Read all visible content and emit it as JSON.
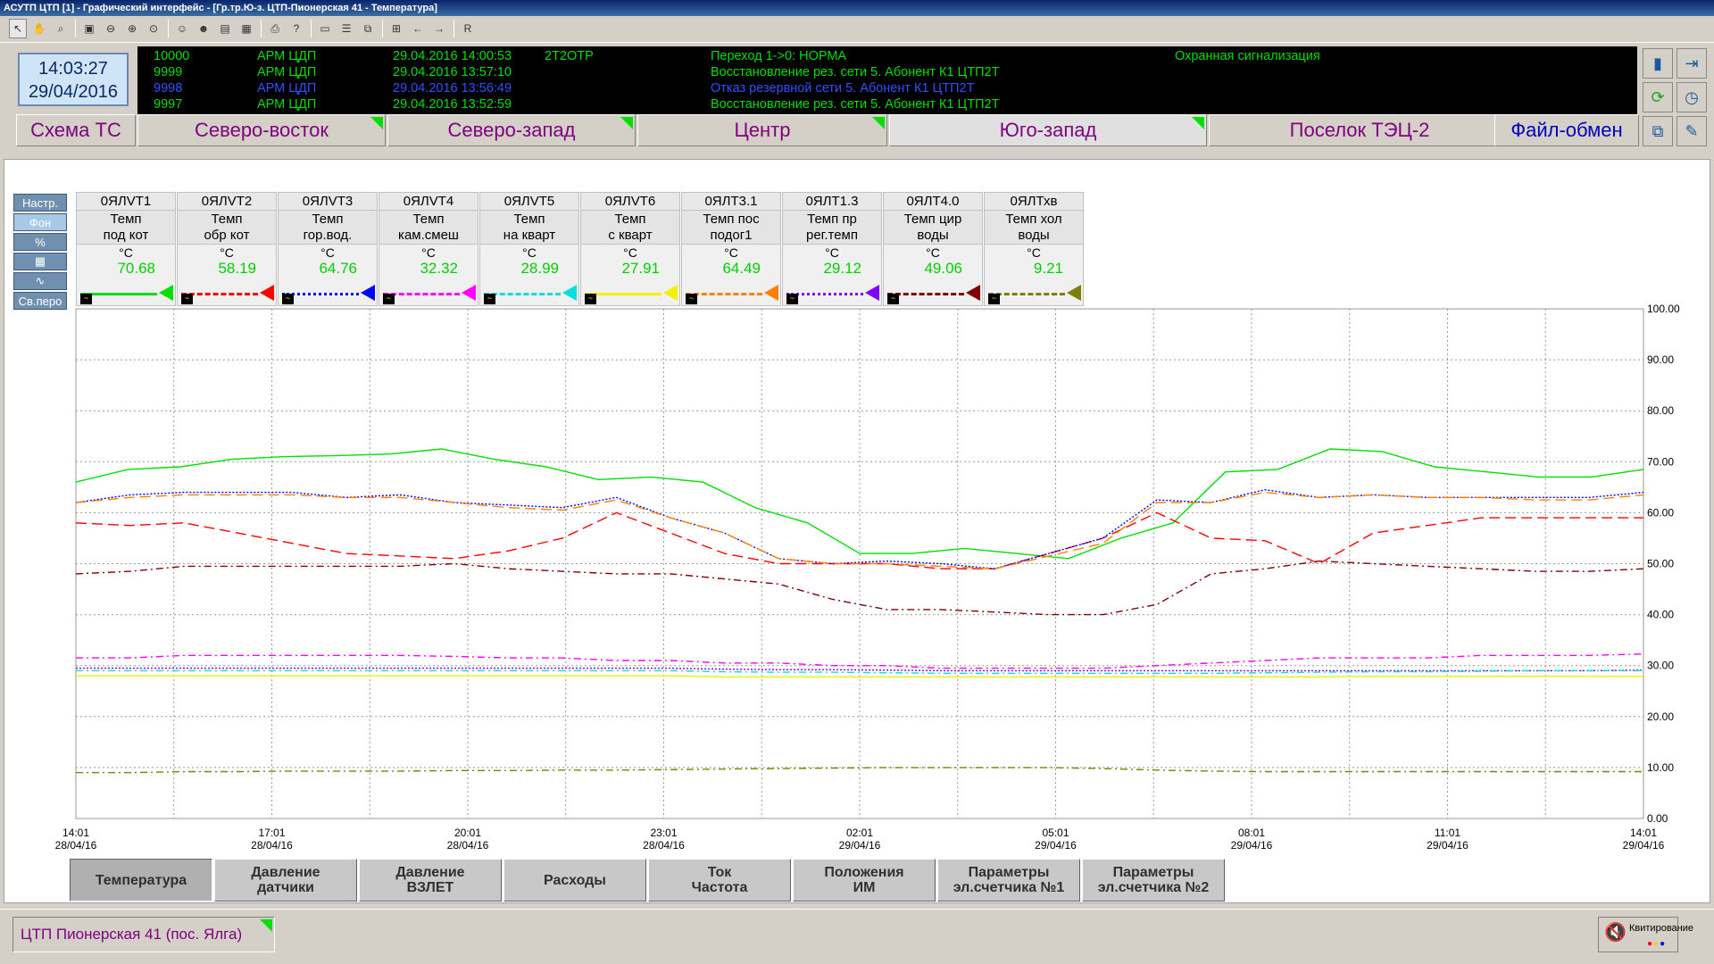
{
  "window": {
    "title": "АСУТП ЦТП [1] - Графический интерфейс - [Гр.тр.Ю-з. ЦТП-Пионерская 41 - Температура]"
  },
  "toolbar": {
    "last_label": "R"
  },
  "clock": {
    "time": "14:03:27",
    "date": "29/04/2016"
  },
  "events": [
    {
      "code": "10000",
      "src": "АРМ ЦДП",
      "ts": "29.04.2016 14:00:53",
      "obj": "2Т2ОТР",
      "msg": "Переход  1->0:      НОРМА",
      "extra": "Охранная сигнализация",
      "color": "#00e000"
    },
    {
      "code": "9999",
      "src": "АРМ ЦДП",
      "ts": "29.04.2016 13:57:10",
      "obj": "",
      "msg": "Восстановление рез. сети 5. Абонент К1 ЦТП2Т",
      "extra": "",
      "color": "#00e000"
    },
    {
      "code": "9998",
      "src": "АРМ ЦДП",
      "ts": "29.04.2016 13:56:49",
      "obj": "",
      "msg": "Отказ резервной сети  5. Абонент К1 ЦТП2Т",
      "extra": "",
      "color": "#3050ff"
    },
    {
      "code": "9997",
      "src": "АРМ ЦДП",
      "ts": "29.04.2016 13:52:59",
      "obj": "",
      "msg": "Восстановление рез. сети 5. Абонент К1 ЦТП2Т",
      "extra": "",
      "color": "#00e000"
    }
  ],
  "nav_tabs": [
    {
      "label": "Схема ТС",
      "flag": ""
    },
    {
      "label": "Северо-восток",
      "flag": "green"
    },
    {
      "label": "Северо-запад",
      "flag": "green"
    },
    {
      "label": "Центр",
      "flag": "green"
    },
    {
      "label": "Юго-запад",
      "flag": "green"
    },
    {
      "label": "Поселок ТЭЦ-2",
      "flag": "yellow"
    },
    {
      "label": "Файл-обмен",
      "flag": ""
    }
  ],
  "left_buttons": [
    "Настр.",
    "Фон",
    "%",
    "",
    "",
    "Св.перо"
  ],
  "pens": [
    {
      "tag": "0ЯЛVТ1",
      "desc1": "Темп",
      "desc2": "под кот",
      "unit": "°C",
      "value": "70.68",
      "color": "#00e000",
      "style": "solid"
    },
    {
      "tag": "0ЯЛVТ2",
      "desc1": "Темп",
      "desc2": "обр кот",
      "unit": "°C",
      "value": "58.19",
      "color": "#ff0000",
      "style": "dashed"
    },
    {
      "tag": "0ЯЛVТ3",
      "desc1": "Темп",
      "desc2": "гор.вод.",
      "unit": "°C",
      "value": "64.76",
      "color": "#0000ff",
      "style": "dotted"
    },
    {
      "tag": "0ЯЛVТ4",
      "desc1": "Темп",
      "desc2": "кам.смеш",
      "unit": "°C",
      "value": "32.32",
      "color": "#ff00ff",
      "style": "dashdot"
    },
    {
      "tag": "0ЯЛVТ5",
      "desc1": "Темп",
      "desc2": "на кварт",
      "unit": "°C",
      "value": "28.99",
      "color": "#00e0e0",
      "style": "dashdot"
    },
    {
      "tag": "0ЯЛVТ6",
      "desc1": "Темп",
      "desc2": "с кварт",
      "unit": "°C",
      "value": "27.91",
      "color": "#f0f000",
      "style": "solid"
    },
    {
      "tag": "0ЯЛТ3.1",
      "desc1": "Темп пос",
      "desc2": "подог1",
      "unit": "°C",
      "value": "64.49",
      "color": "#ff8000",
      "style": "dashed"
    },
    {
      "tag": "0ЯЛТ1.3",
      "desc1": "Темп пр",
      "desc2": "рег.темп",
      "unit": "°C",
      "value": "29.12",
      "color": "#8000ff",
      "style": "dotted"
    },
    {
      "tag": "0ЯЛТ4.0",
      "desc1": "Темп цир",
      "desc2": "воды",
      "unit": "°C",
      "value": "49.06",
      "color": "#800000",
      "style": "dashdot"
    },
    {
      "tag": "0ЯЛТхв",
      "desc1": "Темп хол",
      "desc2": "воды",
      "unit": "°C",
      "value": "9.21",
      "color": "#808000",
      "style": "dashdot"
    }
  ],
  "chart_data": {
    "type": "line",
    "ylim": [
      0,
      100
    ],
    "yticks": [
      "0.00",
      "10.00",
      "20.00",
      "30.00",
      "40.00",
      "50.00",
      "60.00",
      "70.00",
      "80.00",
      "90.00",
      "100.00"
    ],
    "xticks": [
      {
        "t": "14:01",
        "d": "28/04/16"
      },
      {
        "t": "17:01",
        "d": "28/04/16"
      },
      {
        "t": "20:01",
        "d": "28/04/16"
      },
      {
        "t": "23:01",
        "d": "28/04/16"
      },
      {
        "t": "02:01",
        "d": "29/04/16"
      },
      {
        "t": "05:01",
        "d": "29/04/16"
      },
      {
        "t": "08:01",
        "d": "29/04/16"
      },
      {
        "t": "11:01",
        "d": "29/04/16"
      },
      {
        "t": "14:01",
        "d": "29/04/16"
      }
    ],
    "x_hours": [
      0,
      1,
      2,
      3,
      4,
      5,
      6,
      7,
      8,
      9,
      10,
      11,
      11.5,
      12,
      12.5,
      13,
      13.5,
      14,
      14.5,
      15,
      15.5,
      16,
      17,
      18,
      19,
      20,
      21,
      22,
      23,
      24
    ],
    "series": [
      {
        "pen": 0,
        "values": [
          66,
          68.5,
          69,
          70.5,
          71,
          71.2,
          71.5,
          72.5,
          70.5,
          69,
          66.5,
          67,
          66,
          61,
          58,
          52,
          52,
          53,
          52,
          51,
          55,
          58,
          68,
          68.5,
          72.5,
          72,
          69,
          68,
          67,
          67,
          68.5
        ]
      },
      {
        "pen": 1,
        "values": [
          58,
          57.5,
          58,
          56,
          54,
          52,
          51.5,
          51,
          52.5,
          55,
          60,
          56,
          52,
          50,
          50,
          50,
          49,
          49,
          52,
          55,
          60,
          55,
          54.5,
          50,
          56,
          57.5,
          59,
          59,
          59,
          59
        ]
      },
      {
        "pen": 2,
        "values": [
          62,
          63.5,
          64,
          64,
          64,
          63,
          63.5,
          62,
          61.5,
          61,
          63,
          59,
          56,
          51,
          50,
          50.5,
          50,
          49,
          52,
          55,
          62.5,
          62,
          64.5,
          63,
          63.5,
          63,
          63,
          63,
          63,
          64
        ]
      },
      {
        "pen": 6,
        "values": [
          62,
          63,
          63.5,
          63.5,
          63.5,
          63,
          63,
          62,
          61,
          60.5,
          62.5,
          59,
          56,
          51,
          50,
          50,
          49.5,
          49,
          51.5,
          54,
          62,
          62,
          64,
          63,
          63.5,
          63,
          63,
          62.5,
          62.5,
          63.5
        ]
      },
      {
        "pen": 8,
        "values": [
          48,
          48.5,
          49.5,
          49.5,
          49.5,
          49.5,
          49.5,
          50,
          49,
          48.5,
          48,
          48,
          47,
          46,
          43,
          41,
          41,
          40.5,
          40,
          40,
          42,
          48,
          49,
          50.5,
          50,
          49.5,
          49,
          48.5,
          48.5,
          49
        ]
      },
      {
        "pen": 3,
        "values": [
          31.5,
          31.5,
          32,
          32,
          32,
          32,
          32,
          31.8,
          31.5,
          31.5,
          31,
          31,
          30.5,
          30.5,
          30,
          30,
          29.5,
          29.5,
          29.5,
          29.5,
          30,
          30.5,
          31,
          31.5,
          31.5,
          31.5,
          32,
          32,
          32,
          32.3
        ]
      },
      {
        "pen": 7,
        "values": [
          29.5,
          29.5,
          29.5,
          29.5,
          29.5,
          29.5,
          29.5,
          29.5,
          29.5,
          29.5,
          29.5,
          29.5,
          29.3,
          29.2,
          29.2,
          29.1,
          29,
          29,
          29,
          29,
          29,
          29,
          29,
          29,
          29,
          29,
          29,
          29,
          29,
          29.1
        ]
      },
      {
        "pen": 4,
        "values": [
          29,
          29,
          29,
          29,
          29,
          29,
          29,
          29,
          29,
          29,
          29,
          29,
          28.8,
          28.7,
          28.7,
          28.6,
          28.5,
          28.5,
          28.5,
          28.5,
          28.5,
          28.5,
          28.6,
          28.7,
          28.8,
          28.8,
          28.9,
          29,
          29,
          29
        ]
      },
      {
        "pen": 5,
        "values": [
          28,
          28,
          28,
          28,
          28,
          28,
          28,
          28,
          28,
          28,
          28,
          28,
          27.8,
          27.8,
          27.8,
          27.8,
          27.8,
          27.8,
          27.8,
          27.8,
          27.8,
          27.8,
          27.8,
          27.8,
          27.9,
          27.9,
          27.9,
          27.9,
          27.9,
          27.9
        ]
      },
      {
        "pen": 9,
        "values": [
          9,
          9,
          9.2,
          9.2,
          9.3,
          9.3,
          9.3,
          9.4,
          9.4,
          9.5,
          9.5,
          9.6,
          9.7,
          9.8,
          9.9,
          10,
          10,
          10,
          10,
          9.8,
          9.5,
          9.3,
          9.2,
          9.2,
          9.2,
          9.2,
          9.2,
          9.2,
          9.2,
          9.2
        ]
      }
    ]
  },
  "bottom_tabs": [
    {
      "l1": "Температура",
      "l2": "",
      "selected": true
    },
    {
      "l1": "Давление",
      "l2": "датчики",
      "selected": false
    },
    {
      "l1": "Давление",
      "l2": "ВЗЛЕТ",
      "selected": false
    },
    {
      "l1": "Расходы",
      "l2": "",
      "selected": false
    },
    {
      "l1": "Ток",
      "l2": "Частота",
      "selected": false
    },
    {
      "l1": "Положения",
      "l2": "ИМ",
      "selected": false
    },
    {
      "l1": "Параметры",
      "l2": "эл.счетчика №1",
      "selected": false
    },
    {
      "l1": "Параметры",
      "l2": "эл.счетчика №2",
      "selected": false
    }
  ],
  "status": {
    "station": "ЦТП Пионерская 41 (пос. Ялга)",
    "ack_label": "Квитирование"
  }
}
